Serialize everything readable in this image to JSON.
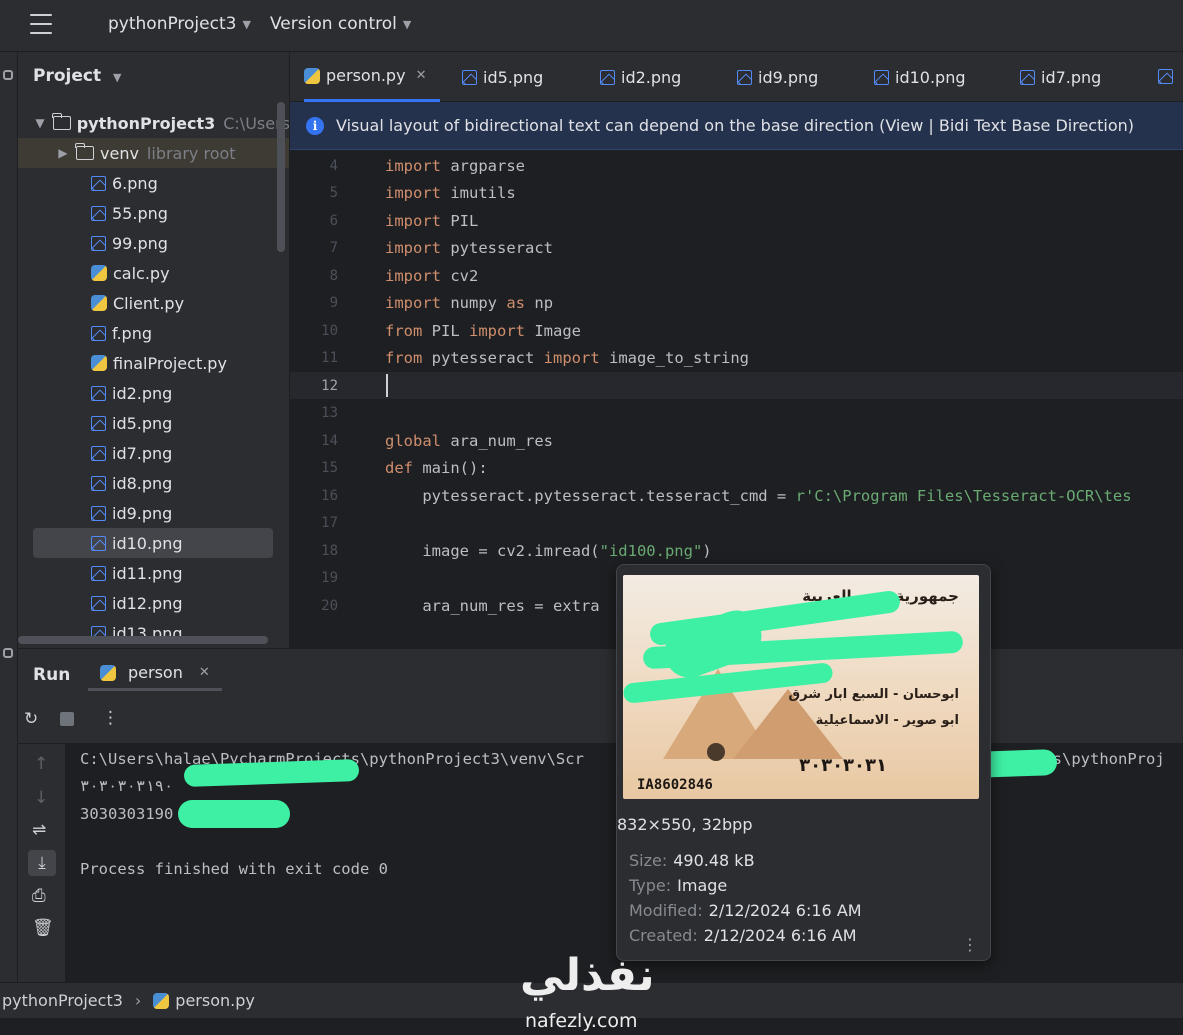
{
  "titlebar": {
    "project_name": "pythonProject3",
    "vcs_label": "Version control"
  },
  "project_panel": {
    "title": "Project",
    "root": {
      "name": "pythonProject3",
      "path_hint": "C:\\Users"
    },
    "venv": {
      "name": "venv",
      "hint": "library root"
    },
    "files": [
      {
        "name": "6.png",
        "kind": "image"
      },
      {
        "name": "55.png",
        "kind": "image"
      },
      {
        "name": "99.png",
        "kind": "image"
      },
      {
        "name": "calc.py",
        "kind": "python"
      },
      {
        "name": "Client.py",
        "kind": "python"
      },
      {
        "name": "f.png",
        "kind": "image"
      },
      {
        "name": "finalProject.py",
        "kind": "python"
      },
      {
        "name": "id2.png",
        "kind": "image"
      },
      {
        "name": "id5.png",
        "kind": "image"
      },
      {
        "name": "id7.png",
        "kind": "image"
      },
      {
        "name": "id8.png",
        "kind": "image"
      },
      {
        "name": "id9.png",
        "kind": "image"
      },
      {
        "name": "id10.png",
        "kind": "image",
        "selected": true
      },
      {
        "name": "id11.png",
        "kind": "image"
      },
      {
        "name": "id12.png",
        "kind": "image"
      },
      {
        "name": "id13.png",
        "kind": "image"
      }
    ]
  },
  "tabs": [
    {
      "label": "person.py",
      "kind": "python",
      "active": true
    },
    {
      "label": "id5.png",
      "kind": "image"
    },
    {
      "label": "id2.png",
      "kind": "image"
    },
    {
      "label": "id9.png",
      "kind": "image"
    },
    {
      "label": "id10.png",
      "kind": "image"
    },
    {
      "label": "id7.png",
      "kind": "image"
    }
  ],
  "banner": {
    "text": "Visual layout of bidirectional text can depend on the base direction (View | Bidi Text Base Direction)"
  },
  "editor": {
    "current_line": 12,
    "lines": [
      {
        "n": "4",
        "tokens": [
          [
            "kw",
            "import"
          ],
          [
            "",
            "argparse"
          ]
        ]
      },
      {
        "n": "5",
        "tokens": [
          [
            "kw",
            "import"
          ],
          [
            "",
            "imutils"
          ]
        ]
      },
      {
        "n": "6",
        "tokens": [
          [
            "kw",
            "import"
          ],
          [
            "",
            "PIL"
          ]
        ]
      },
      {
        "n": "7",
        "tokens": [
          [
            "kw",
            "import"
          ],
          [
            "",
            "pytesseract"
          ]
        ]
      },
      {
        "n": "8",
        "tokens": [
          [
            "kw",
            "import"
          ],
          [
            "",
            "cv2"
          ]
        ]
      },
      {
        "n": "9",
        "tokens": [
          [
            "kw",
            "import"
          ],
          [
            "",
            "numpy "
          ],
          [
            "kw",
            "as"
          ],
          [
            "",
            "np"
          ]
        ]
      },
      {
        "n": "10",
        "tokens": [
          [
            "kw",
            "from"
          ],
          [
            "",
            "PIL "
          ],
          [
            "kw",
            "import"
          ],
          [
            "",
            "Image"
          ]
        ]
      },
      {
        "n": "11",
        "tokens": [
          [
            "kw",
            "from"
          ],
          [
            "",
            "pytesseract "
          ],
          [
            "kw",
            "import"
          ],
          [
            "",
            "image_to_string"
          ]
        ]
      },
      {
        "n": "12",
        "tokens": []
      },
      {
        "n": "13",
        "tokens": []
      },
      {
        "n": "14",
        "tokens": [
          [
            "kw",
            "global"
          ],
          [
            "",
            "ara_num_res"
          ]
        ]
      },
      {
        "n": "15",
        "tokens": [
          [
            "kw",
            "def"
          ],
          [
            "",
            "main():"
          ]
        ]
      },
      {
        "n": "16",
        "tokens": [
          [
            "",
            "    pytesseract.pytesseract.tesseract_cmd = "
          ],
          [
            "str",
            "r'C:\\Program Files\\Tesseract-OCR\\tes"
          ]
        ]
      },
      {
        "n": "17",
        "tokens": []
      },
      {
        "n": "18",
        "tokens": [
          [
            "",
            "    image = cv2.imread("
          ],
          [
            "str",
            "\"id100.png\""
          ],
          [
            "",
            ")"
          ]
        ]
      },
      {
        "n": "19",
        "tokens": []
      },
      {
        "n": "20",
        "tokens": [
          [
            "",
            "    ara_num_res = extra"
          ]
        ]
      }
    ]
  },
  "run": {
    "title": "Run",
    "tab_label": "person",
    "console": {
      "line1": "C:\\Users\\halae\\PycharmProjects\\pythonProject3\\venv\\Scr",
      "line1_tail": "cts\\pythonProj",
      "line2": "٣٠٣٠٣٠٣١٩٠",
      "line3": "3030303190",
      "line5": "Process finished with exit code 0"
    }
  },
  "popup": {
    "card": {
      "header_ar": "جمهورية مصر العربية",
      "addr1_ar": "ابوحسان - السبع ابار شرق",
      "addr2_ar": "ابو صوير - الاسماعيلية",
      "id_number_ar": "٣٠٣٠٣٠٣١",
      "serial": "IA8602846"
    },
    "dims": "832×550, 32bpp",
    "meta": [
      {
        "key": "Size:",
        "value": "490.48 kB"
      },
      {
        "key": "Type:",
        "value": "Image"
      },
      {
        "key": "Modified:",
        "value": "2/12/2024 6:16 AM"
      },
      {
        "key": "Created:",
        "value": "2/12/2024 6:16 AM"
      }
    ]
  },
  "statusbar": {
    "project": "pythonProject3",
    "file": "person.py"
  },
  "watermark": {
    "arabic": "نفذلي",
    "latin": "nafezly.com"
  }
}
